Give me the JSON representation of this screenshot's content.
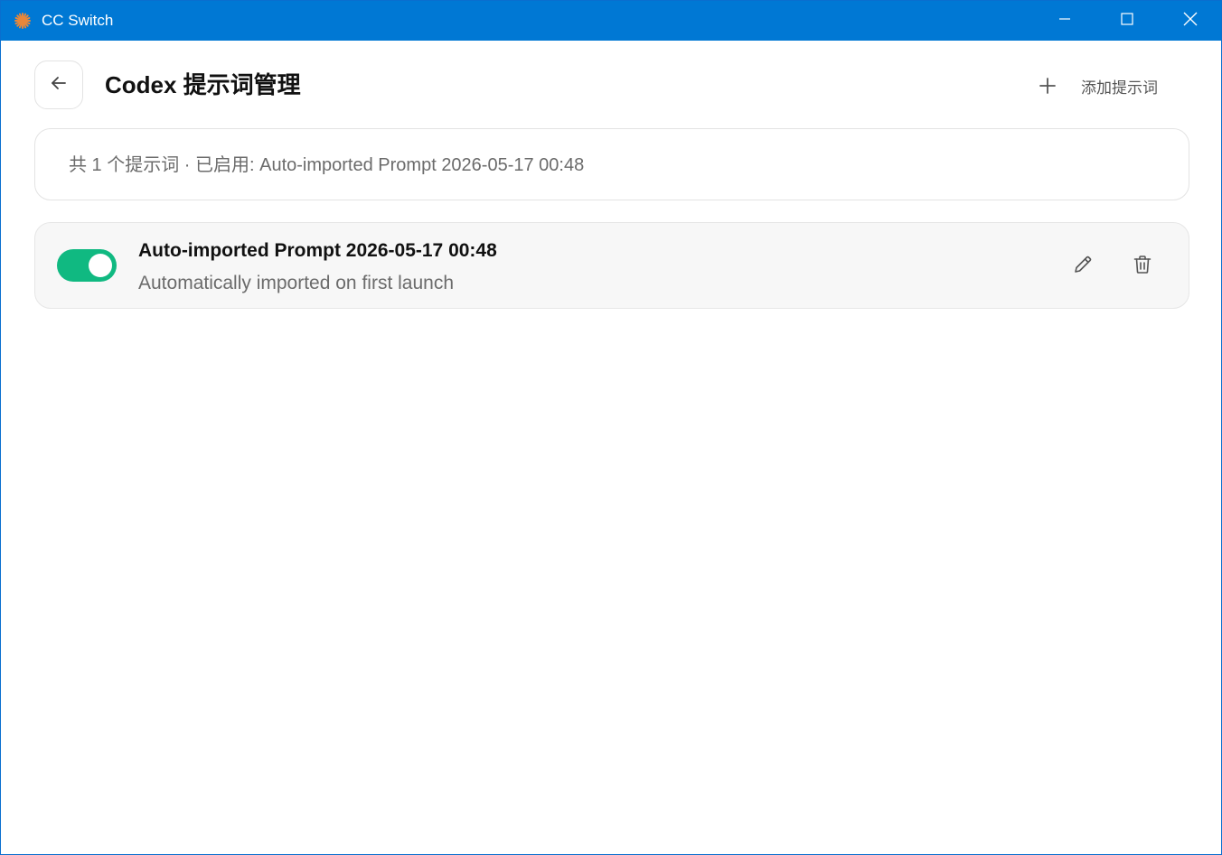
{
  "window": {
    "title": "CC Switch",
    "accent_color": "#0078d4",
    "controls": [
      "minimize-icon",
      "maximize-icon",
      "close-icon"
    ]
  },
  "header": {
    "back_icon": "arrow-left-icon",
    "title": "Codex 提示词管理",
    "add_icon": "plus-icon",
    "add_label": "添加提示词"
  },
  "summary": {
    "text": "共 1 个提示词 · 已启用: Auto-imported Prompt 2026-05-17 00:48"
  },
  "prompts": [
    {
      "enabled": true,
      "toggle_color": "#10b981",
      "title": "Auto-imported Prompt 2026-05-17 00:48",
      "description": "Automatically imported on first launch",
      "actions": [
        "pencil-icon",
        "trash-icon"
      ]
    }
  ]
}
